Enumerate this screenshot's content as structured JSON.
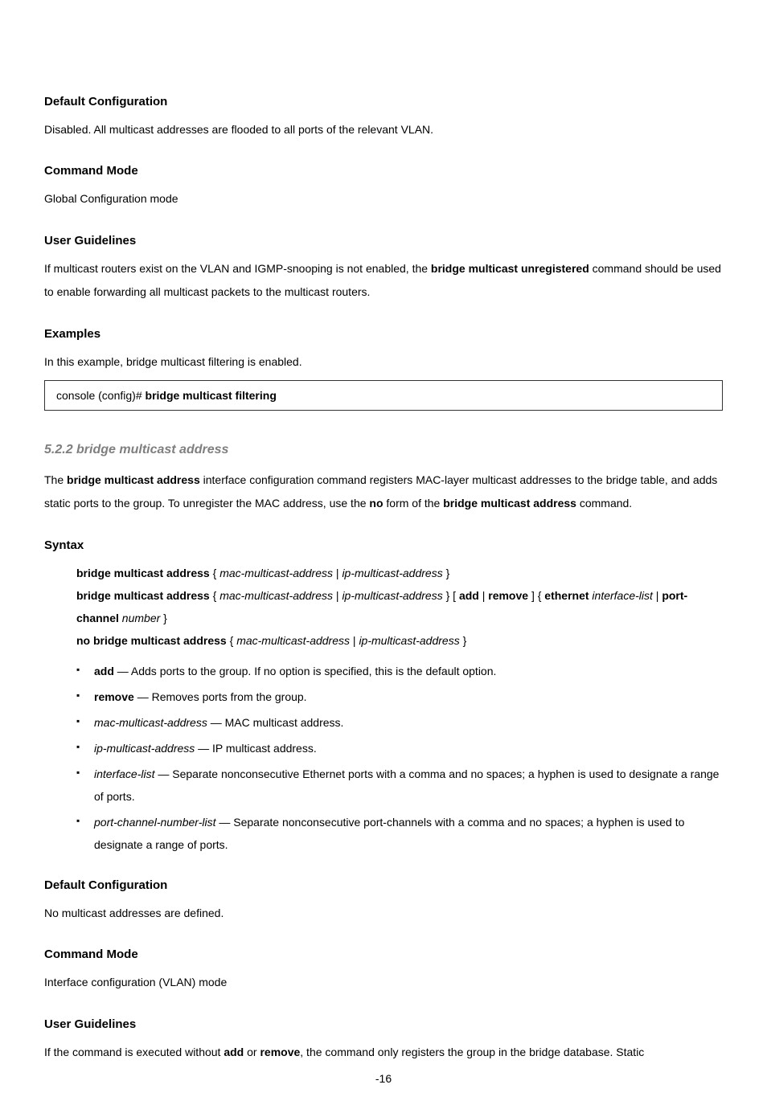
{
  "sections": {
    "default_cfg": {
      "title": "Default Configuration",
      "body": "Disabled. All multicast addresses are flooded to all ports of the relevant VLAN."
    },
    "cmd_mode1": {
      "title": "Command Mode",
      "body": "Global Configuration mode"
    },
    "user_guide1": {
      "title": "User Guidelines",
      "pre": "If multicast routers exist on the VLAN and IGMP-snooping is not enabled, the ",
      "cmd": "bridge multicast unregistered",
      "post": " command should be used to enable forwarding all multicast packets to the multicast routers."
    },
    "examples": {
      "title": "Examples",
      "intro": "In this example, bridge multicast filtering is enabled.",
      "code_prompt": "console (config)# ",
      "code_cmd": "bridge multicast filtering"
    },
    "cmd2_heading": "5.2.2 bridge multicast address",
    "cmd2_desc": {
      "pre": "The ",
      "cmd1": "bridge multicast address",
      "mid1": " interface configuration command registers MAC-layer multicast addresses to the bridge table, and adds static ports to the group. To unregister the MAC address, use the ",
      "no": "no",
      "mid2": " form of the ",
      "cmd2": "bridge multicast address",
      "post": " command."
    },
    "syntax": {
      "title": "Syntax",
      "l1_a": "bridge multicast address",
      "l1_b": "mac-multicast-address",
      "l1_c": "ip-multicast-address",
      "l2_a": "bridge multicast address",
      "l2_b": "mac-multicast-address",
      "l2_c": "ip-multicast-address",
      "l2_d": "add",
      "l2_e": "remove",
      "l2_f": "ethernet",
      "l2_g": "interface-list",
      "l2_h": "port-channel",
      "l2_i": "number",
      "l3_a": "no bridge multicast address",
      "l3_b": "mac-multicast-address",
      "l3_c": "ip-multicast-address"
    },
    "bullets": {
      "b1_term": "add",
      "b1_desc": " — Adds ports to the group. If no option is specified, this is the default option.",
      "b2_term": "remove",
      "b2_desc": " — Removes ports from the group.",
      "b3_term": "mac-multicast-address",
      "b3_desc": " — MAC multicast address.",
      "b4_term": "ip-multicast-address",
      "b4_desc": " — IP multicast address.",
      "b5_term": "interface-list",
      "b5_desc": " — Separate nonconsecutive Ethernet ports with a comma and no spaces; a hyphen is used to designate a range of ports.",
      "b6_term": "port-channel-number-list",
      "b6_desc": " — Separate nonconsecutive port-channels with a comma and no spaces; a hyphen is used to designate a range of ports."
    },
    "default_cfg2": {
      "title": "Default Configuration",
      "body": "No multicast addresses are defined."
    },
    "cmd_mode2": {
      "title": "Command Mode",
      "body": "Interface configuration (VLAN) mode"
    },
    "user_guide2": {
      "title": "User Guidelines",
      "pre": "If the command is executed without ",
      "w1": "add",
      "mid": " or ",
      "w2": "remove",
      "post": ", the command only registers the group in the bridge database. Static"
    }
  },
  "footer": "-16"
}
